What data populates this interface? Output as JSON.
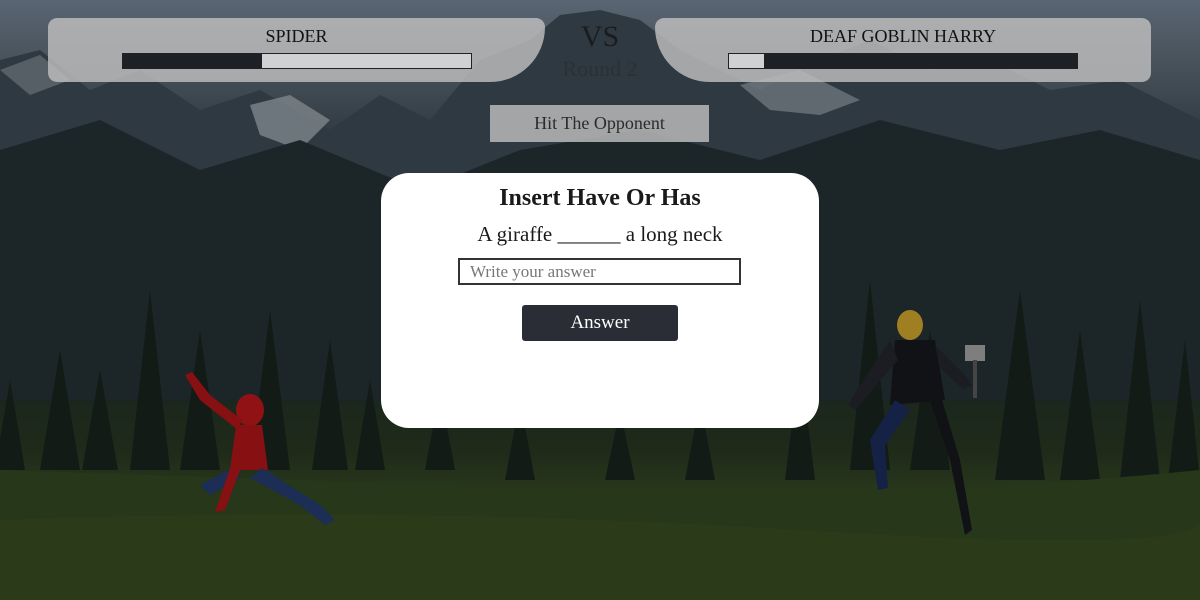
{
  "player": {
    "name": "SPIDER",
    "health_fraction": 0.4
  },
  "opponent": {
    "name": "DEAF GOBLIN HARRY",
    "health_fraction": 0.1
  },
  "vs_label": "VS",
  "round_label": "Round 2",
  "hit_button_label": "Hit The Opponent",
  "question": {
    "title": "Insert Have Or Has",
    "sentence": "A giraffe ______ a long neck",
    "input_placeholder": "Write your answer",
    "input_value": "",
    "submit_label": "Answer"
  }
}
